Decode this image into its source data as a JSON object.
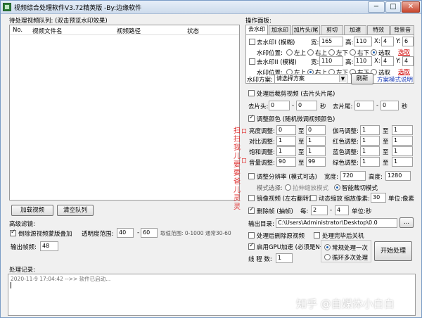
{
  "window": {
    "title": "视频综合处理软件V3.72精英版 -By:边缘软件",
    "buttons": {
      "minimize": "−",
      "maximize": "□",
      "close": "✕"
    }
  },
  "queue": {
    "label": "待处理视频队列: (双击预览水印效果)",
    "columns": [
      "No.",
      "视频文件名",
      "视频路径",
      "状态"
    ],
    "load_button": "加载视频",
    "clear_button": "清空队列"
  },
  "filter": {
    "label": "高级滤镜:",
    "reverse_label": "倒除源视频蒙版叠加",
    "reverse_checked": true,
    "transparency_label": "透明度范围:",
    "transparency_min": "40",
    "dash": "-",
    "transparency_max": "60",
    "hint": "取值范围: 0-1000  通常30-60",
    "fps_label": "输出帧频:",
    "fps_value": "48"
  },
  "ops": {
    "label": "操作面板:",
    "tabs": [
      "去水印",
      "加水印",
      "加片头/尾",
      "剪切",
      "加速",
      "特效",
      "背景音"
    ],
    "active_tab": "去水印",
    "wm1": {
      "checkbox": "去水印I (模糊)",
      "checked": false,
      "w_label": "宽:",
      "w": "165",
      "h_label": "高:",
      "h": "110",
      "x_label": "X:",
      "x": "4",
      "y_label": "Y:",
      "y": "6",
      "pos_label": "水印位置:",
      "positions": [
        "左上",
        "右上",
        "左下",
        "右下",
        "选取"
      ],
      "selected": "选取",
      "pick_link": "选取"
    },
    "wm2": {
      "checkbox": "去水印II (模糊)",
      "checked": false,
      "w_label": "宽:",
      "w": "110",
      "h_label": "高:",
      "h": "110",
      "x_label": "X:",
      "x": "4",
      "y_label": "Y:",
      "y": "4",
      "pos_label": "水印位置:",
      "positions": [
        "左上",
        "右上",
        "左下",
        "右下",
        "选取"
      ],
      "selected": "右上",
      "pick_link": "选取"
    },
    "scheme_label": "水印方案:",
    "scheme_value": "请选择方案",
    "refresh_button": "刷新",
    "scheme_help": "方案模式说明"
  },
  "trim": {
    "checkbox": "处理后裁剪视频 (去片头片尾)",
    "checked": false,
    "head_label": "去片头:",
    "head_min": "0",
    "head_max": "0",
    "unit": "秒",
    "tail_label": "去片尾:",
    "tail_min": "0",
    "tail_max": "0",
    "dash": "-"
  },
  "color": {
    "checkbox": "调整颜色 (随机微调视频颜色)",
    "checked": true,
    "rows": [
      {
        "l_label": "亮度调整:",
        "l_min": "0",
        "l_mid": "至",
        "l_max": "0",
        "r_label": "伽马调整:",
        "r_min": "1",
        "r_mid": "至",
        "r_max": "1"
      },
      {
        "l_label": "对比调整:",
        "l_min": "1",
        "l_mid": "至",
        "l_max": "1",
        "r_label": "红色调整:",
        "r_min": "1",
        "r_mid": "至",
        "r_max": "1"
      },
      {
        "l_label": "饱和调整:",
        "l_min": "1",
        "l_mid": "至",
        "l_max": "1",
        "r_label": "蓝色调整:",
        "r_min": "1",
        "r_mid": "至",
        "r_max": "1"
      },
      {
        "l_label": "音量调整:",
        "l_min": "90",
        "l_mid": "至",
        "l_max": "99",
        "r_label": "绿色调整:",
        "r_min": "1",
        "r_mid": "至",
        "r_max": "1"
      }
    ]
  },
  "resolution": {
    "checkbox": "调整分辨率 (模式可选)",
    "checked": false,
    "width_label": "宽度:",
    "width": "720",
    "height_label": "高度:",
    "height": "1280",
    "mode_label": "模式选择:",
    "mode_stretch": "拉伸缩放模式",
    "mode_smart": "智能裁切模式",
    "selected": "智能裁切模式"
  },
  "mirror": {
    "checkbox": "镜像视频 (左右翻转)",
    "checked": false,
    "zoom_checkbox": "动态缩放",
    "zoom_checked": false,
    "pixel_label": "缩放像素:",
    "pixel": "30",
    "unit": "单位:像素"
  },
  "drop": {
    "checkbox": "删除帧 (抽帧)",
    "checked": true,
    "every_label": "每:",
    "min": "2",
    "dash": "-",
    "max": "4",
    "unit": "单位:秒"
  },
  "output": {
    "label": "输出目录:",
    "path": "C:\\Users\\Administrator\\Desktop\\0.0",
    "browse": "..."
  },
  "after": {
    "delete_source": "处理后删除原视频",
    "delete_checked": false,
    "shutdown": "处理完毕后关机",
    "shutdown_checked": false
  },
  "gpu": {
    "checkbox": "启用GPU加速 (必须是N卡)",
    "checked": true,
    "threads_label": "线 程 数:",
    "threads": "1",
    "mode_once": "常规处理一次",
    "mode_loop": "循环多次处理",
    "selected": "常规处理一次",
    "start_button": "开始处理"
  },
  "side_text": [
    "扫",
    "扫",
    "我",
    "儿",
    "要",
    "要",
    "爸",
    "儿",
    "灵",
    "灵"
  ],
  "side_text_bracket": [
    "口",
    "口"
  ],
  "log": {
    "label": "处理记录:",
    "entry": "2020-11-9 17:04:42 -->> 软件已启动..."
  },
  "watermark": "知乎 @自媒体小白白"
}
